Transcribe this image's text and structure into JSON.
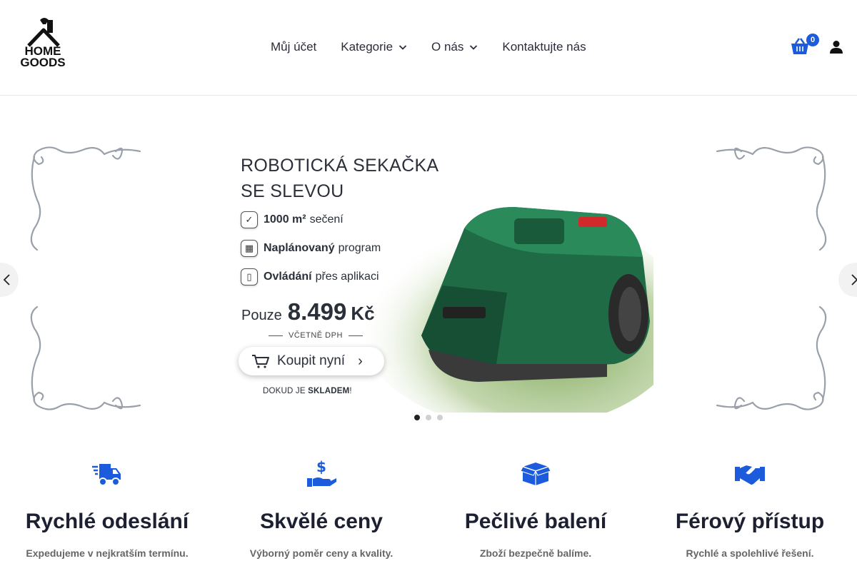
{
  "header": {
    "logo": {
      "line1": "HOME",
      "line2": "GOODS"
    },
    "nav": [
      {
        "label": "Můj účet",
        "has_dropdown": false
      },
      {
        "label": "Kategorie",
        "has_dropdown": true
      },
      {
        "label": "O nás",
        "has_dropdown": true
      },
      {
        "label": "Kontaktujte nás",
        "has_dropdown": false
      }
    ],
    "cart_count": "0",
    "icons": {
      "cart": "basket-icon",
      "account": "user-icon"
    },
    "accent_color": "#1c5bdb"
  },
  "slider": {
    "title_line1": "ROBOTICKÁ SEKAČKA",
    "title_line2": "SE SLEVOU",
    "features": [
      {
        "bold": "1000 m²",
        "text": "sečení",
        "icon": "check-icon"
      },
      {
        "bold": "Naplánovaný",
        "text": "program",
        "icon": "calendar-icon"
      },
      {
        "bold": "Ovládání",
        "text": "přes aplikaci",
        "icon": "phone-icon"
      }
    ],
    "price_label": "Pouze",
    "price_value": "8.499",
    "price_currency": "Kč",
    "vat_note": "VČETNĚ DPH",
    "buy_label": "Koupit nyní",
    "stock_prefix": "DOKUD JE",
    "stock_bold": "SKLADEM",
    "stock_suffix": "!",
    "active_slide": 1,
    "slide_count": 3
  },
  "features": [
    {
      "icon": "delivery-truck-icon",
      "title": "Rychlé odeslání",
      "desc": "Expedujeme v nejkratším termínu."
    },
    {
      "icon": "hand-dollar-icon",
      "title": "Skvělé ceny",
      "desc": "Výborný poměr ceny a kvality."
    },
    {
      "icon": "open-box-icon",
      "title": "Pečlivé balení",
      "desc": "Zboží bezpečně balíme."
    },
    {
      "icon": "handshake-icon",
      "title": "Férový přístup",
      "desc": "Rychlé a spolehlivé řešení."
    }
  ]
}
